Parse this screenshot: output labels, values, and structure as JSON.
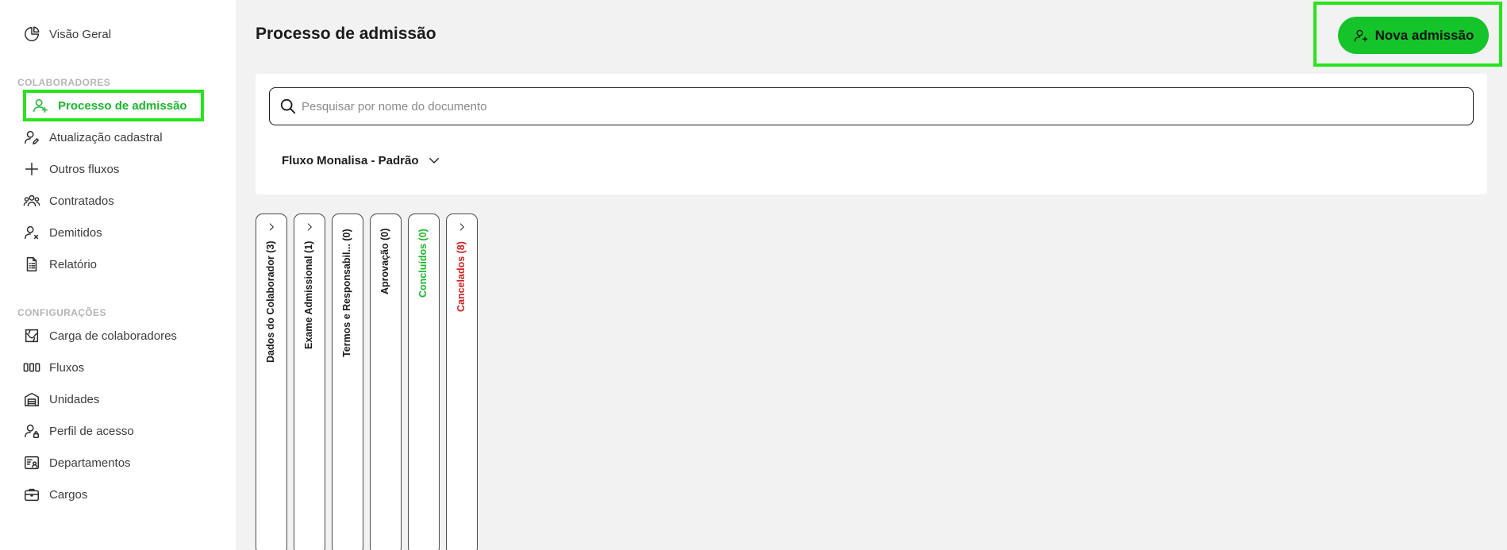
{
  "sidebar": {
    "overview": "Visão Geral",
    "sections": [
      {
        "label": "COLABORADORES",
        "items": [
          {
            "label": "Processo de admissão",
            "icon": "user-plus-icon",
            "active": true
          },
          {
            "label": "Atualização cadastral",
            "icon": "user-edit-icon"
          },
          {
            "label": "Outros fluxos",
            "icon": "plus-icon"
          },
          {
            "label": "Contratados",
            "icon": "users-group-icon"
          },
          {
            "label": "Demitidos",
            "icon": "user-remove-icon"
          },
          {
            "label": "Relatório",
            "icon": "report-icon"
          }
        ]
      },
      {
        "label": "CONFIGURAÇÕES",
        "items": [
          {
            "label": "Carga de colaboradores",
            "icon": "upload-map-icon"
          },
          {
            "label": "Fluxos",
            "icon": "flow-icon"
          },
          {
            "label": "Unidades",
            "icon": "building-icon"
          },
          {
            "label": "Perfil de acesso",
            "icon": "user-lock-icon"
          },
          {
            "label": "Departamentos",
            "icon": "department-icon"
          },
          {
            "label": "Cargos",
            "icon": "briefcase-icon"
          }
        ]
      }
    ]
  },
  "header": {
    "title": "Processo de admissão",
    "new_button": "Nova admissão"
  },
  "search": {
    "placeholder": "Pesquisar por nome do documento",
    "value": ""
  },
  "flow_selector": {
    "selected": "Fluxo Monalisa - Padrão"
  },
  "columns": [
    {
      "label": "Dados do Colaborador (3)",
      "chevron": true,
      "color": "#1b1b1b"
    },
    {
      "label": "Exame Admissional (1)",
      "chevron": true,
      "color": "#1b1b1b"
    },
    {
      "label": "Termos e Responsabil... (0)",
      "chevron": false,
      "color": "#1b1b1b"
    },
    {
      "label": "Aprovação (0)",
      "chevron": false,
      "color": "#1b1b1b"
    },
    {
      "label": "Concluídos (0)",
      "chevron": false,
      "color": "#18b92a"
    },
    {
      "label": "Cancelados (8)",
      "chevron": true,
      "color": "#d21f1f"
    }
  ],
  "colors": {
    "accent": "#15c42a",
    "highlight": "#27e41c",
    "danger": "#d21f1f"
  }
}
